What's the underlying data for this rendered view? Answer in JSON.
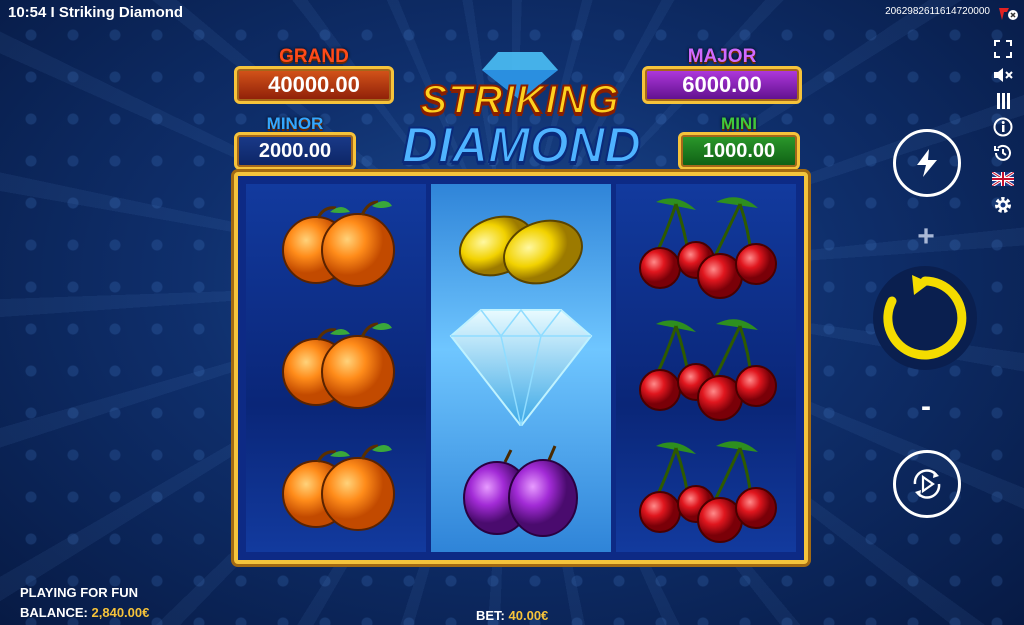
{
  "window": {
    "time": "10:54",
    "separator": "I",
    "title": "Striking Diamond",
    "session_id": "2062982611614720000"
  },
  "jackpots": {
    "grand": {
      "label": "GRAND",
      "value": "40000.00",
      "label_color": "#ff4a1a"
    },
    "major": {
      "label": "MAJOR",
      "value": "6000.00",
      "label_color": "#c63aff"
    },
    "minor": {
      "label": "MINOR",
      "value": "2000.00",
      "label_color": "#33a7ff"
    },
    "mini": {
      "label": "MINI",
      "value": "1000.00",
      "label_color": "#3ec83e"
    }
  },
  "logo": {
    "line1": "STRIKING",
    "line2": "DIAMOND"
  },
  "reels": [
    [
      "orange",
      "orange",
      "orange"
    ],
    [
      "lemon",
      "diamond",
      "plum"
    ],
    [
      "cherry",
      "cherry",
      "cherry"
    ]
  ],
  "side_menu": [
    "fullscreen-icon",
    "mute-icon",
    "menu-icon",
    "info-icon",
    "history-icon",
    "language-flag-icon",
    "settings-icon"
  ],
  "controls": {
    "plus": "+",
    "minus": "-",
    "turbo": "lightning-icon",
    "spin": "spin-icon",
    "autoplay": "autoplay-icon"
  },
  "footer": {
    "mode": "PLAYING FOR FUN",
    "balance_label": "BALANCE:",
    "balance_value": "2,840.00€",
    "bet_label": "BET:",
    "bet_value": "40.00€"
  },
  "colors": {
    "frame": "#f6c33a",
    "spin_ring": "#f4dc00"
  }
}
